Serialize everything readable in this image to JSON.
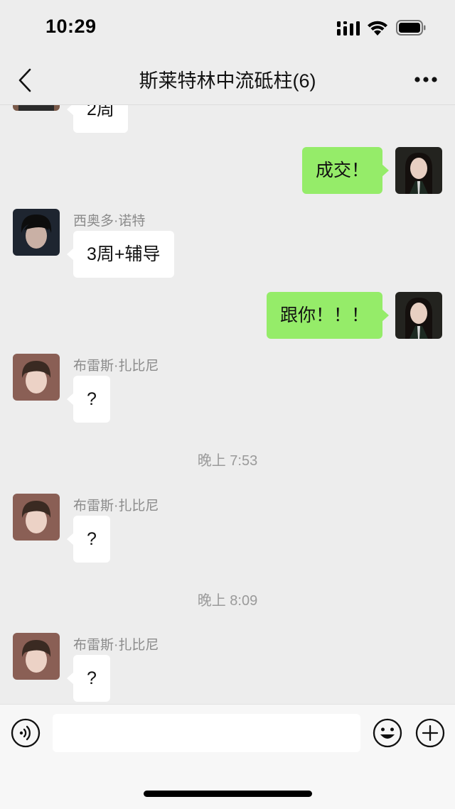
{
  "status_bar": {
    "time": "10:29"
  },
  "nav": {
    "title": "斯莱特林中流砥柱(6)",
    "back_icon": "chevron-left-icon",
    "more_icon": "more-dots-icon"
  },
  "messages": [
    {
      "type": "incoming",
      "text": "2周"
    },
    {
      "type": "outgoing",
      "text": "成交！"
    },
    {
      "type": "incoming",
      "sender": "西奥多·诺特",
      "text": "3周+辅导"
    },
    {
      "type": "outgoing",
      "text": "跟你！！！"
    },
    {
      "type": "incoming",
      "sender": "布雷斯·扎比尼",
      "text": "?"
    },
    {
      "type": "timestamp",
      "text": "晚上 7:53"
    },
    {
      "type": "incoming",
      "sender": "布雷斯·扎比尼",
      "text": "?"
    },
    {
      "type": "timestamp",
      "text": "晚上 8:09"
    },
    {
      "type": "incoming",
      "sender": "布雷斯·扎比尼",
      "text": "?"
    }
  ],
  "input_bar": {
    "placeholder": "",
    "voice_icon": "voice-icon",
    "emoji_icon": "emoji-icon",
    "plus_icon": "plus-icon"
  },
  "colors": {
    "outgoing_bubble": "#95ec69",
    "incoming_bubble": "#ffffff",
    "background": "#ededed"
  }
}
